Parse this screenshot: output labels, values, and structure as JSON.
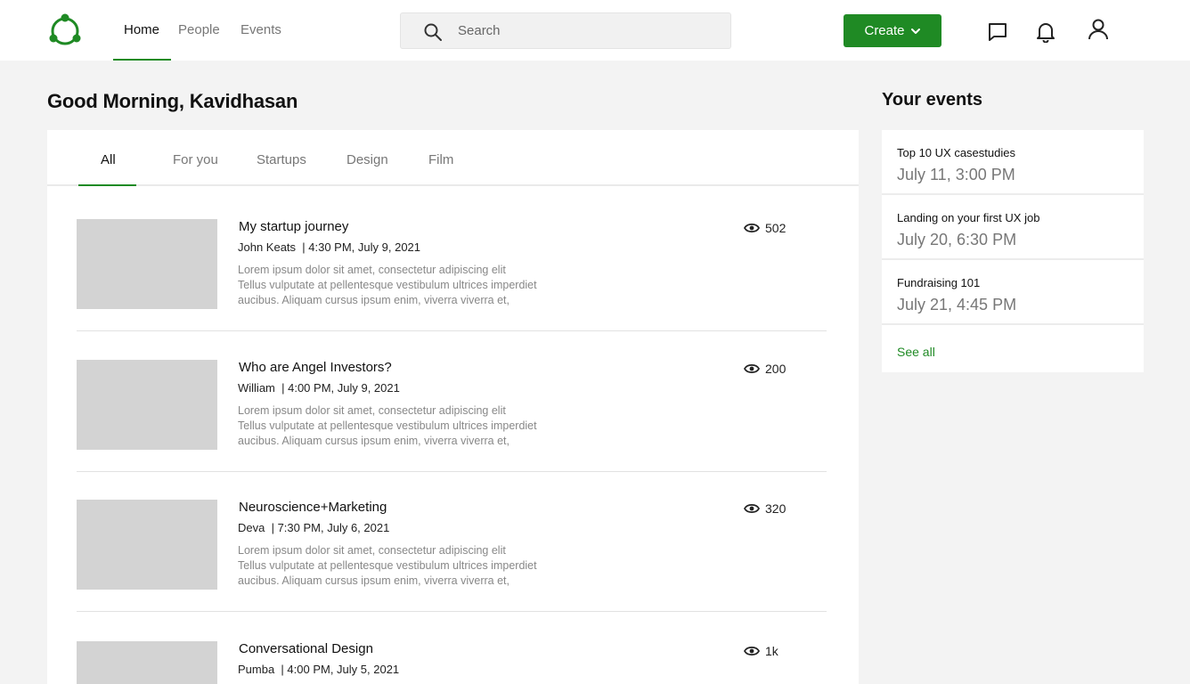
{
  "nav": {
    "items": [
      {
        "label": "Home",
        "active": true
      },
      {
        "label": "People",
        "active": false
      },
      {
        "label": "Events",
        "active": false
      }
    ]
  },
  "search": {
    "placeholder": "Search",
    "value": ""
  },
  "actions": {
    "create_label": "Create"
  },
  "icons": {
    "chat": "chat-icon",
    "bell": "bell-icon",
    "profile": "user-icon",
    "logo": "logo-icon"
  },
  "colors": {
    "accent": "#1f8a24",
    "thumbnail": "#d3d3d3"
  },
  "greeting": "Good Morning, Kavidhasan",
  "tabs": [
    {
      "label": "All",
      "active": true
    },
    {
      "label": "For you",
      "active": false
    },
    {
      "label": "Startups",
      "active": false
    },
    {
      "label": "Design",
      "active": false
    },
    {
      "label": "Film",
      "active": false
    }
  ],
  "posts": [
    {
      "title": "My startup journey",
      "author": "John Keats",
      "datetime": "4:30 PM, July 9, 2021",
      "excerpt_lines": [
        "Lorem ipsum dolor sit amet, consectetur adipiscing elit",
        "Tellus vulputate at pellentesque vestibulum ultrices imperdiet",
        "aucibus. Aliquam cursus ipsum enim, viverra viverra et,"
      ],
      "views": "502"
    },
    {
      "title": "Who are Angel Investors?",
      "author": "William",
      "datetime": "4:00 PM, July 9, 2021",
      "excerpt_lines": [
        "Lorem ipsum dolor sit amet, consectetur adipiscing elit",
        "Tellus vulputate at pellentesque vestibulum ultrices imperdiet",
        "aucibus. Aliquam cursus ipsum enim, viverra viverra et,"
      ],
      "views": "200"
    },
    {
      "title": "Neuroscience+Marketing",
      "author": "Deva",
      "datetime": "7:30 PM, July 6, 2021",
      "excerpt_lines": [
        "Lorem ipsum dolor sit amet, consectetur adipiscing elit",
        "Tellus vulputate at pellentesque vestibulum ultrices imperdiet",
        "aucibus. Aliquam cursus ipsum enim, viverra viverra et,"
      ],
      "views": "320"
    },
    {
      "title": "Conversational Design",
      "author": "Pumba",
      "datetime": "4:00 PM, July 5, 2021",
      "views": "1k"
    }
  ],
  "events_panel": {
    "title": "Your events",
    "items": [
      {
        "name": "Top 10 UX casestudies",
        "time": "July 11, 3:00 PM"
      },
      {
        "name": "Landing on your first UX job",
        "time": "July 20, 6:30 PM"
      },
      {
        "name": "Fundraising 101",
        "time": "July 21, 4:45 PM"
      }
    ],
    "see_all": "See all"
  }
}
